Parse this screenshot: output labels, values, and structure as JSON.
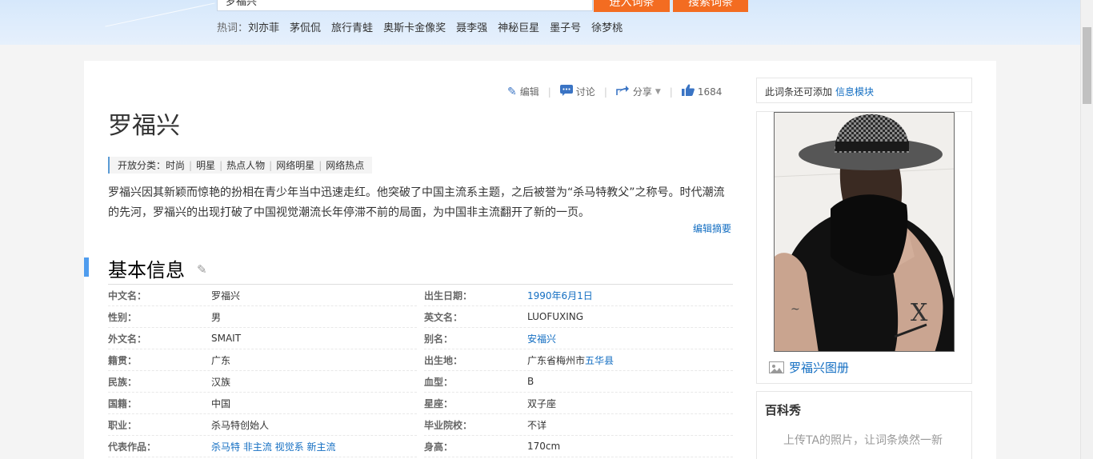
{
  "header": {
    "search_value": "罗福兴",
    "enter_button": "进入词条",
    "search_button": "搜索词条",
    "hot_label": "热词：",
    "hot_words": [
      "刘亦菲",
      "茅侃侃",
      "旅行青蛙",
      "奥斯卡金像奖",
      "聂李强",
      "神秘巨星",
      "墨子号",
      "徐梦桃"
    ]
  },
  "toolbar": {
    "edit": "编辑",
    "discuss": "讨论",
    "share": "分享",
    "like_count": "1684"
  },
  "entry": {
    "title": "罗福兴",
    "category_label": "开放分类：",
    "categories": [
      "时尚",
      "明星",
      "热点人物",
      "网络明星",
      "网络热点"
    ],
    "summary": "罗福兴因其新颖而惊艳的扮相在青少年当中迅速走红。他突破了中国主流系主题，之后被誉为“杀马特教父”之称号。时代潮流的先河，罗福兴的出现打破了中国视觉潮流长年停滞不前的局面，为中国非主流翻开了新的一页。",
    "edit_summary": "编辑摘要"
  },
  "basic_info": {
    "title": "基本信息",
    "left": [
      {
        "k": "中文名：",
        "v": "罗福兴"
      },
      {
        "k": "性别：",
        "v": "男"
      },
      {
        "k": "外文名：",
        "v": "SMAIT"
      },
      {
        "k": "籍贯：",
        "v": "广东"
      },
      {
        "k": "民族：",
        "v": "汉族"
      },
      {
        "k": "国籍：",
        "v": "中国"
      },
      {
        "k": "职业：",
        "v": "杀马特创始人"
      },
      {
        "k": "代表作品：",
        "v": "杀马特 非主流 视觉系 新主流"
      }
    ],
    "right": [
      {
        "k": "出生日期：",
        "v": "1990年6月1日"
      },
      {
        "k": "英文名：",
        "v": "LUOFUXING"
      },
      {
        "k": "别名：",
        "v": "安福兴"
      },
      {
        "k": "出生地：",
        "v": "广东省梅州市",
        "v_link": "五华县"
      },
      {
        "k": "血型：",
        "v": "B"
      },
      {
        "k": "星座：",
        "v": "双子座"
      },
      {
        "k": "毕业院校：",
        "v": "不详"
      },
      {
        "k": "身高：",
        "v": "170cm"
      }
    ]
  },
  "sidebar": {
    "add_text": "此词条还可添加",
    "add_link": "信息模块",
    "album": "罗福兴图册",
    "show_title": "百科秀",
    "show_desc": "上传TA的照片，让词条焕然一新"
  },
  "colors": {
    "accent": "#136ec2",
    "orange": "#f36c21",
    "section_bar": "#4f9cee"
  }
}
